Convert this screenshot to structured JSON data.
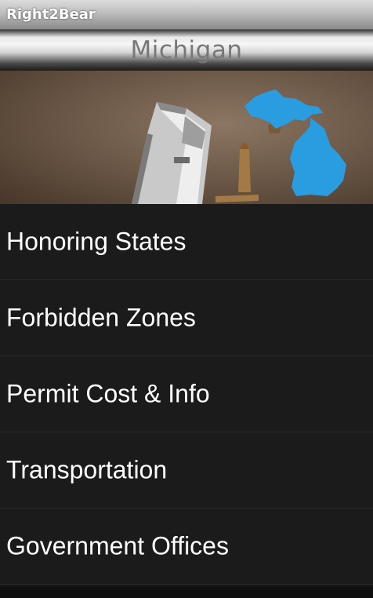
{
  "app": {
    "title": "Right2Bear"
  },
  "header": {
    "state_name": "Michigan"
  },
  "hero": {
    "image": "state-hero-image",
    "map_color": "#2a9de0"
  },
  "menu": {
    "items": [
      {
        "label": "Honoring States"
      },
      {
        "label": "Forbidden Zones"
      },
      {
        "label": "Permit Cost & Info"
      },
      {
        "label": "Transportation"
      },
      {
        "label": "Government Offices"
      }
    ]
  }
}
